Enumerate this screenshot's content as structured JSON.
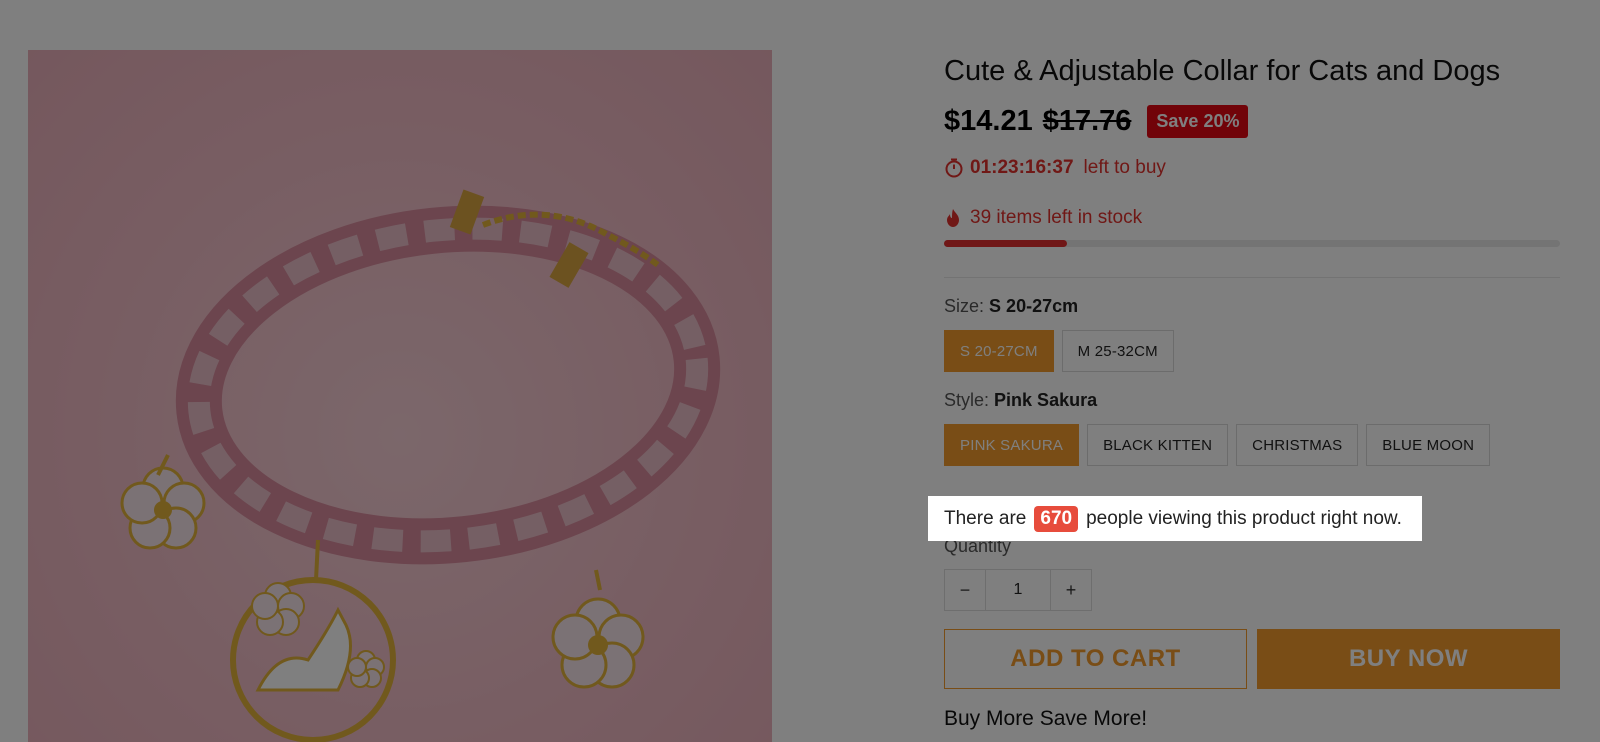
{
  "product": {
    "title": "Cute & Adjustable Collar for Cats and Dogs",
    "price": "$14.21",
    "compare_price": "$17.76",
    "save_badge": "Save 20%"
  },
  "timer": {
    "value": "01:23:16:37",
    "text": "left to buy",
    "icon": "stopwatch-icon"
  },
  "stock": {
    "text": "39 items left in stock",
    "icon": "flame-icon",
    "progress_fraction": 0.2
  },
  "size_option": {
    "label": "Size:",
    "selected": "S 20-27cm",
    "choices": [
      "S 20-27CM",
      "M 25-32CM"
    ],
    "active_index": 0
  },
  "style_option": {
    "label": "Style:",
    "selected": "Pink Sakura",
    "choices": [
      "PINK SAKURA",
      "BLACK KITTEN",
      "CHRISTMAS",
      "BLUE MOON"
    ],
    "active_index": 0
  },
  "viewers": {
    "prefix": "There are",
    "count": "670",
    "suffix": "people viewing this product right now."
  },
  "quantity": {
    "label": "Quantity",
    "minus": "−",
    "value": "1",
    "plus": "+"
  },
  "actions": {
    "add_to_cart": "ADD TO CART",
    "buy_now": "BUY NOW"
  },
  "promo": {
    "text": "Buy More Save More!"
  },
  "colors": {
    "accent": "#f29b2c",
    "sale_red": "#e30613",
    "urgency_red": "#e0312d",
    "viewer_badge": "#e74c3c"
  }
}
